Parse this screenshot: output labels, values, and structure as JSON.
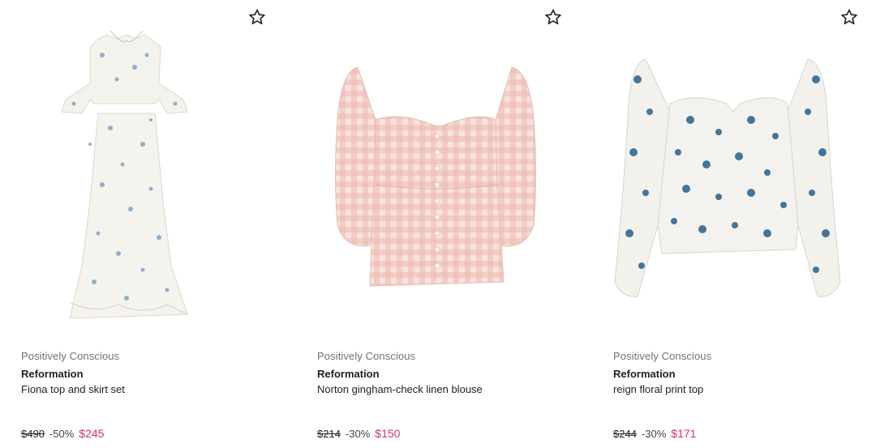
{
  "colors": {
    "sale_price": "#d6335c",
    "muted": "#727272",
    "text": "#222222"
  },
  "products": [
    {
      "tag": "Positively Conscious",
      "brand": "Reformation",
      "name": "Fiona top and skirt set",
      "original_price": "$490",
      "discount": "-50%",
      "sale_price": "$245",
      "favorite_icon": "star-outline-icon"
    },
    {
      "tag": "Positively Conscious",
      "brand": "Reformation",
      "name": "Norton gingham-check linen blouse",
      "original_price": "$214",
      "discount": "-30%",
      "sale_price": "$150",
      "favorite_icon": "star-outline-icon"
    },
    {
      "tag": "Positively Conscious",
      "brand": "Reformation",
      "name": "reign floral print top",
      "original_price": "$244",
      "discount": "-30%",
      "sale_price": "$171",
      "favorite_icon": "star-outline-icon"
    }
  ]
}
